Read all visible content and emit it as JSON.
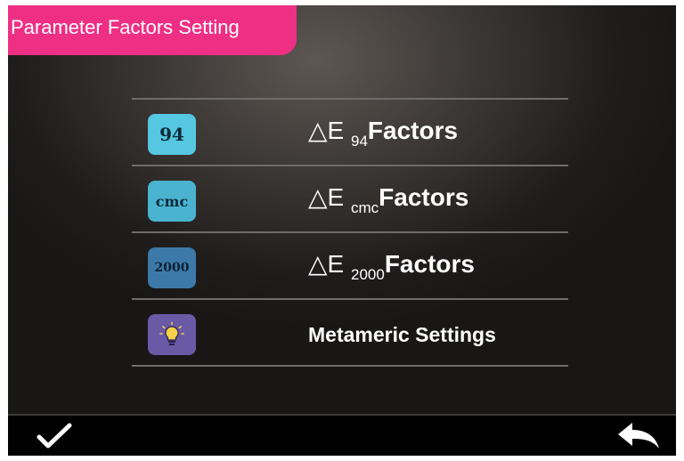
{
  "header": {
    "title": "Parameter Factors Setting"
  },
  "menu": {
    "items": [
      {
        "icon_text": "94",
        "icon": "94-badge-icon",
        "prefix": "△E",
        "sub": "94",
        "suffix": "Factors"
      },
      {
        "icon_text": "cmc",
        "icon": "cmc-badge-icon",
        "prefix": "△E",
        "sub": "cmc",
        "suffix": "Factors"
      },
      {
        "icon_text": "2000",
        "icon": "2000-badge-icon",
        "prefix": "△E",
        "sub": "2000",
        "suffix": "Factors"
      },
      {
        "icon": "lightbulb-icon",
        "label": "Metameric Settings"
      }
    ]
  },
  "footer": {
    "confirm_icon": "checkmark-icon",
    "back_icon": "back-arrow-icon"
  },
  "colors": {
    "title_bg": "#ee2f84",
    "icon_94": "#55c7e1",
    "icon_cmc": "#4ab3cf",
    "icon_2000": "#3c79a8",
    "icon_meta": "#6a5aa6"
  }
}
